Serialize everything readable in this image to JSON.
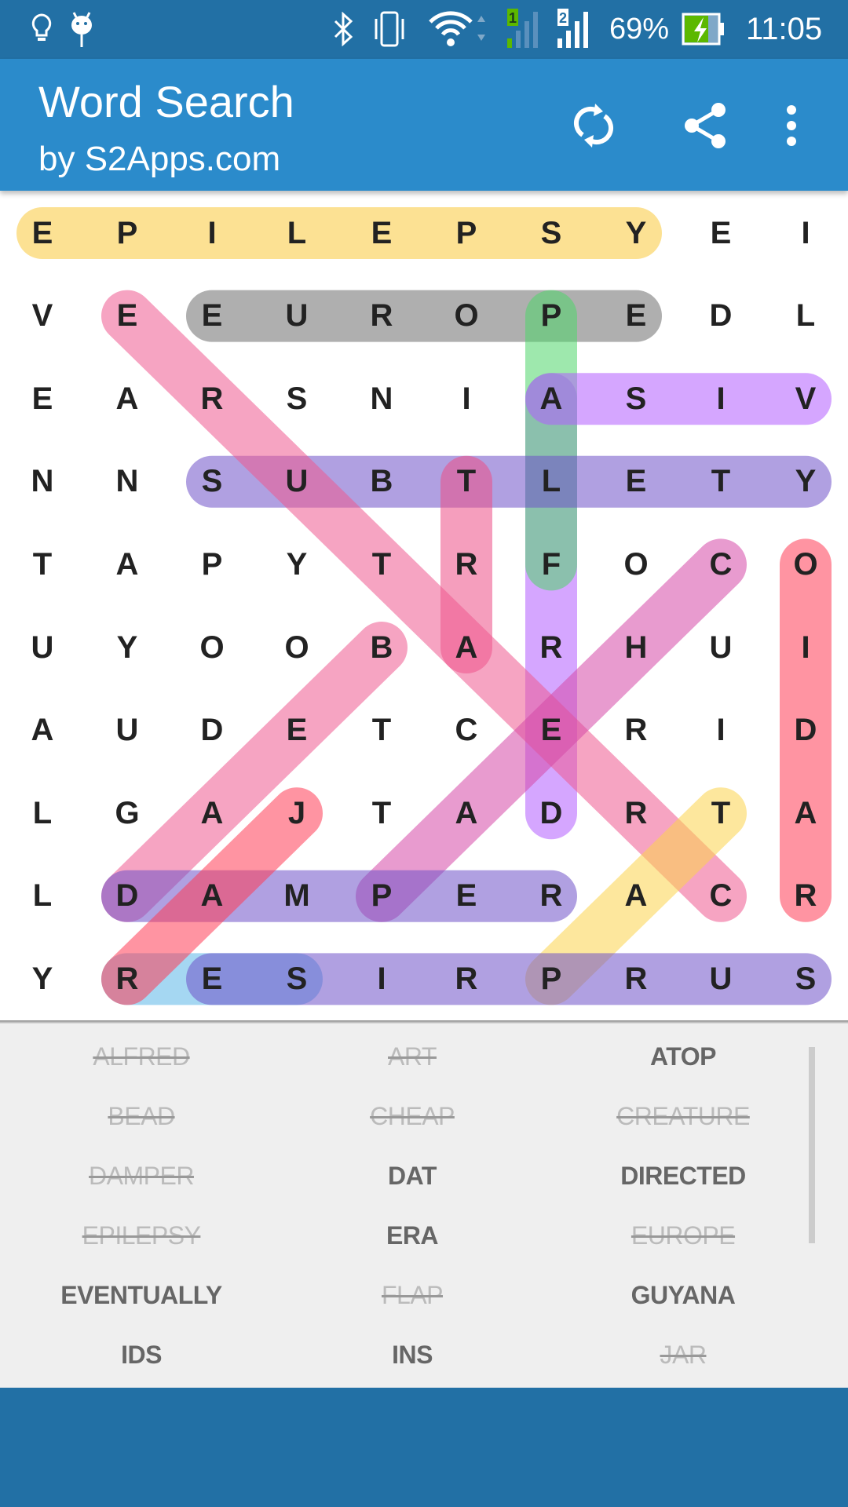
{
  "status_bar": {
    "icons": [
      "lightbulb-icon",
      "android-icon",
      "bluetooth-icon",
      "vibrate-icon",
      "wifi-icon",
      "signal-sim1-icon",
      "signal-sim2-icon",
      "battery-charging-icon"
    ],
    "sim1": "1",
    "sim2": "2",
    "battery": "69%",
    "battery_level": 0.69,
    "time": "11:05"
  },
  "app_bar": {
    "title": "Word Search",
    "subtitle": "by S2Apps.com",
    "actions": [
      "refresh-icon",
      "share-icon",
      "more-vert-icon"
    ]
  },
  "grid": {
    "rows": [
      "EPILEPSYEI",
      "VEEUROPEDL",
      "EARSNIASIV",
      "NNSUBTLETY",
      "TAPYTRFOCO",
      "UYOOBARHUI",
      "AUDETCERID",
      "LGAJTADRTA",
      "LDAMPERACR",
      "YRESIRPRUS"
    ],
    "highlights": [
      {
        "from": [
          0,
          0
        ],
        "to": [
          0,
          7
        ],
        "color": "#f9c93a"
      },
      {
        "from": [
          1,
          2
        ],
        "to": [
          1,
          7
        ],
        "color": "#6e6e6e"
      },
      {
        "from": [
          2,
          6
        ],
        "to": [
          7,
          6
        ],
        "color": "#b35cff"
      },
      {
        "from": [
          1,
          6
        ],
        "to": [
          4,
          6
        ],
        "color": "#4fd66a"
      },
      {
        "from": [
          2,
          6
        ],
        "to": [
          2,
          9
        ],
        "color": "#b35cff"
      },
      {
        "from": [
          3,
          2
        ],
        "to": [
          3,
          9
        ],
        "color": "#6f52c8"
      },
      {
        "from": [
          3,
          5
        ],
        "to": [
          5,
          5
        ],
        "color": "#ec4f86"
      },
      {
        "from": [
          4,
          9
        ],
        "to": [
          8,
          9
        ],
        "color": "#ff3d55"
      },
      {
        "from": [
          1,
          1
        ],
        "to": [
          8,
          8
        ],
        "color": "#ee5a8f"
      },
      {
        "from": [
          5,
          4
        ],
        "to": [
          8,
          1
        ],
        "color": "#ee5a8f"
      },
      {
        "from": [
          4,
          8
        ],
        "to": [
          8,
          4
        ],
        "color": "#d648a8"
      },
      {
        "from": [
          7,
          8
        ],
        "to": [
          9,
          6
        ],
        "color": "#fcd34d"
      },
      {
        "from": [
          8,
          1
        ],
        "to": [
          8,
          6
        ],
        "color": "#6f52c8"
      },
      {
        "from": [
          9,
          1
        ],
        "to": [
          9,
          3
        ],
        "color": "#5bb7e8"
      },
      {
        "from": [
          9,
          2
        ],
        "to": [
          9,
          9
        ],
        "color": "#6f52c8"
      },
      {
        "from": [
          7,
          3
        ],
        "to": [
          9,
          1
        ],
        "color": "#ff3d55"
      }
    ]
  },
  "words": [
    {
      "text": "ALFRED",
      "found": true
    },
    {
      "text": "ART",
      "found": true
    },
    {
      "text": "ATOP",
      "found": false
    },
    {
      "text": "BEAD",
      "found": true
    },
    {
      "text": "CHEAP",
      "found": true
    },
    {
      "text": "CREATURE",
      "found": true
    },
    {
      "text": "DAMPER",
      "found": true
    },
    {
      "text": "DAT",
      "found": false
    },
    {
      "text": "DIRECTED",
      "found": false
    },
    {
      "text": "EPILEPSY",
      "found": true
    },
    {
      "text": "ERA",
      "found": false
    },
    {
      "text": "EUROPE",
      "found": true
    },
    {
      "text": "EVENTUALLY",
      "found": false
    },
    {
      "text": "FLAP",
      "found": true
    },
    {
      "text": "GUYANA",
      "found": false
    },
    {
      "text": "IDS",
      "found": false
    },
    {
      "text": "INS",
      "found": false
    },
    {
      "text": "JAR",
      "found": true
    }
  ],
  "colors": {
    "status_bar": "#2270a5",
    "app_bar": "#2b8bcb",
    "word_list_bg": "#efefef"
  }
}
